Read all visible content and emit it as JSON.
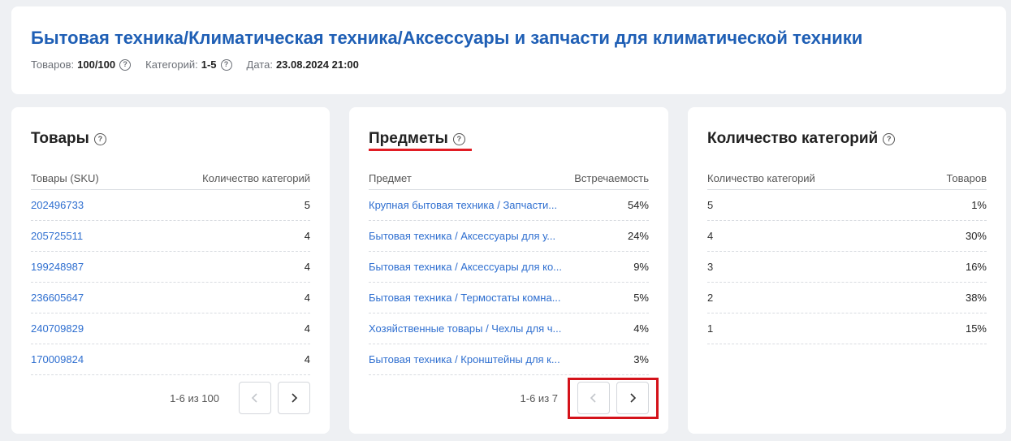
{
  "header": {
    "title": "Бытовая техника/Климатическая техника/Аксессуары и запчасти для климатической техники",
    "goods_label": "Товаров:",
    "goods_value": "100/100",
    "categories_label": "Категорий:",
    "categories_value": "1-5",
    "date_label": "Дата:",
    "date_value": "23.08.2024 21:00"
  },
  "goods_card": {
    "title": "Товары",
    "col1": "Товары (SKU)",
    "col2": "Количество категорий",
    "rows": [
      {
        "sku": "202496733",
        "count": "5"
      },
      {
        "sku": "205725511",
        "count": "4"
      },
      {
        "sku": "199248987",
        "count": "4"
      },
      {
        "sku": "236605647",
        "count": "4"
      },
      {
        "sku": "240709829",
        "count": "4"
      },
      {
        "sku": "170009824",
        "count": "4"
      }
    ],
    "pager_text": "1-6 из 100"
  },
  "subjects_card": {
    "title": "Предметы",
    "col1": "Предмет",
    "col2": "Встречаемость",
    "rows": [
      {
        "name": "Крупная бытовая техника / Запчасти...",
        "share": "54%"
      },
      {
        "name": "Бытовая техника / Аксессуары для у...",
        "share": "24%"
      },
      {
        "name": "Бытовая техника / Аксессуары для ко...",
        "share": "9%"
      },
      {
        "name": "Бытовая техника / Термостаты комна...",
        "share": "5%"
      },
      {
        "name": "Хозяйственные товары / Чехлы для ч...",
        "share": "4%"
      },
      {
        "name": "Бытовая техника / Кронштейны для к...",
        "share": "3%"
      }
    ],
    "pager_text": "1-6 из 7"
  },
  "category_count_card": {
    "title": "Количество категорий",
    "col1": "Количество категорий",
    "col2": "Товаров",
    "rows": [
      {
        "n": "5",
        "share": "1%"
      },
      {
        "n": "4",
        "share": "30%"
      },
      {
        "n": "3",
        "share": "16%"
      },
      {
        "n": "2",
        "share": "38%"
      },
      {
        "n": "1",
        "share": "15%"
      }
    ]
  },
  "icons": {
    "help": "question-circle-icon",
    "prev": "chevron-left-icon",
    "next": "chevron-right-icon"
  },
  "colors": {
    "title_blue": "#1f5fb5",
    "link_blue": "#2f6fd0",
    "accent_red": "#e11d24"
  }
}
